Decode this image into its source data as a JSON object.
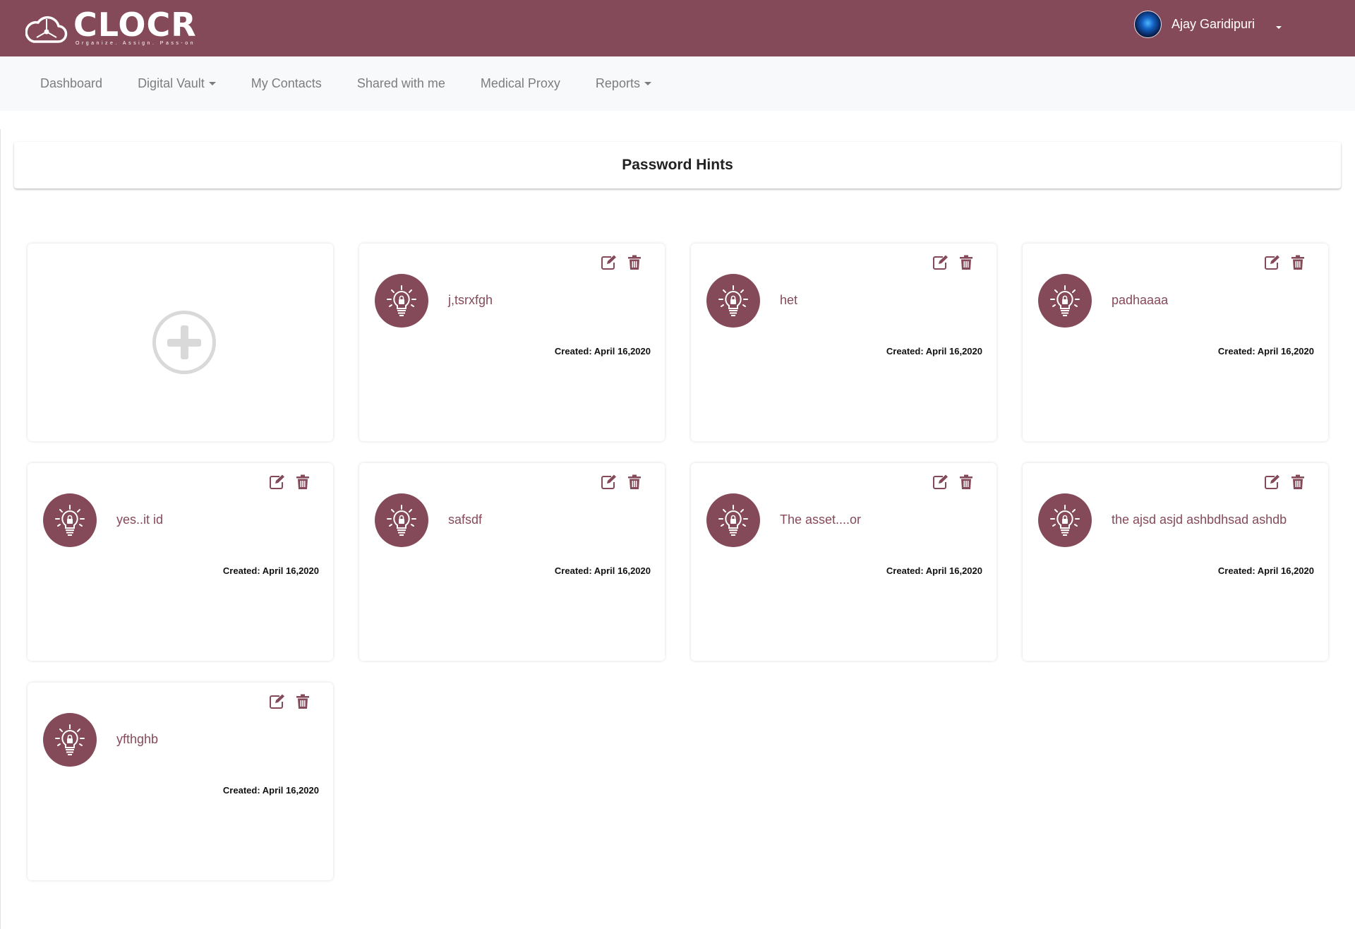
{
  "header": {
    "logo_word": "CLOCR",
    "logo_tagline": "Organize. Assign. Pass-on",
    "user_name": "Ajay Garidipuri"
  },
  "nav": {
    "items": [
      {
        "label": "Dashboard",
        "dropdown": false
      },
      {
        "label": "Digital Vault",
        "dropdown": true
      },
      {
        "label": "My Contacts",
        "dropdown": false
      },
      {
        "label": "Shared with me",
        "dropdown": false
      },
      {
        "label": "Medical Proxy",
        "dropdown": false
      },
      {
        "label": "Reports",
        "dropdown": true
      }
    ]
  },
  "page_title": "Password Hints",
  "colors": {
    "brand": "#854a59",
    "nav_bg": "#f8f9fa",
    "add_icon": "#d9d9d9"
  },
  "icons": {
    "add": "plus-circle-icon",
    "hint": "lightbulb-lock-icon",
    "edit": "edit-icon",
    "delete": "trash-icon"
  },
  "hints": [
    {
      "name": "j,tsrxfgh",
      "created": "Created: April 16,2020"
    },
    {
      "name": "het",
      "created": "Created: April 16,2020"
    },
    {
      "name": "padhaaaa",
      "created": "Created: April 16,2020"
    },
    {
      "name": "yes..it id",
      "created": "Created: April 16,2020"
    },
    {
      "name": "safsdf",
      "created": "Created: April 16,2020"
    },
    {
      "name": "The asset....or",
      "created": "Created: April 16,2020"
    },
    {
      "name": "the ajsd asjd ashbdhsad ashdb",
      "created": "Created: April 16,2020"
    },
    {
      "name": "yfthghb",
      "created": "Created: April 16,2020"
    }
  ]
}
